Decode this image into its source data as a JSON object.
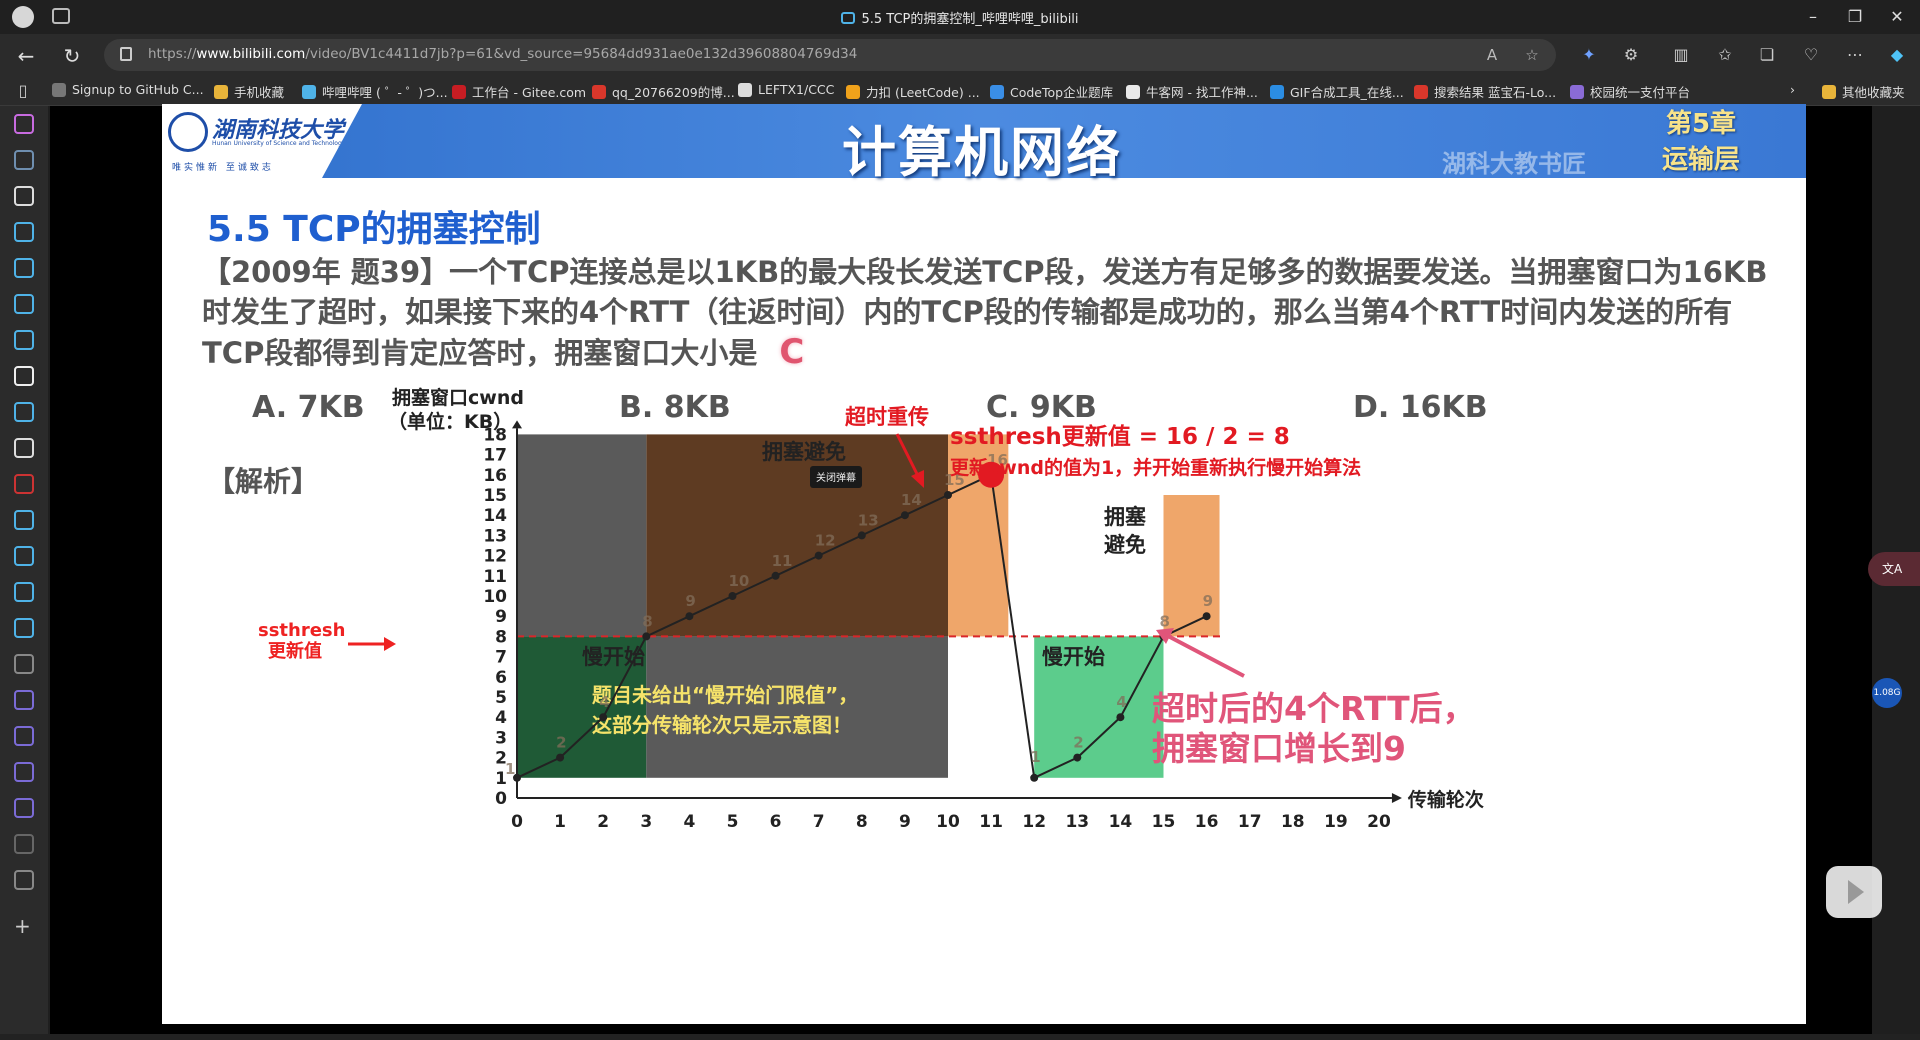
{
  "browser": {
    "window_title": "5.5 TCP的拥塞控制_哔哩哔哩_bilibili",
    "url_prefix": "https://",
    "url_domain": "www.bilibili.com",
    "url_path": "/video/BV1c4411d7jb?p=61&vd_source=95684dd931ae0e132d39608804769d34"
  },
  "bookmarks": [
    {
      "label": "Signup to GitHub C...",
      "color": "#777"
    },
    {
      "label": "手机收藏",
      "color": "#e8b43a"
    },
    {
      "label": "哔哩哔哩 ( ゜- ゜)つ...",
      "color": "#4fb3e8"
    },
    {
      "label": "工作台 - Gitee.com",
      "color": "#c71d23"
    },
    {
      "label": "qq_20766209的博...",
      "color": "#d9372b"
    },
    {
      "label": "LEFTX1/CCC",
      "color": "#ddd"
    },
    {
      "label": "力扣 (LeetCode) ...",
      "color": "#f0a21b"
    },
    {
      "label": "CodeTop企业题库",
      "color": "#3a8ee6"
    },
    {
      "label": "牛客网 - 找工作神...",
      "color": "#e9e9e9"
    },
    {
      "label": "GIF合成工具_在线...",
      "color": "#2b8de3"
    },
    {
      "label": "搜索结果 蓝宝石-Lo...",
      "color": "#d9372b"
    },
    {
      "label": "校园统一支付平台",
      "color": "#8a6bd6"
    }
  ],
  "bookmarks_other": "其他收藏夹",
  "slide": {
    "school": "湖南科技大学",
    "school_en": "Hunan University of Science and Technology",
    "motto": "唯实惟新 至诚致志",
    "course": "计算机网络",
    "chapter": "第5章",
    "chapter_sub": "运输层",
    "watermark": "湖科大教书匠",
    "section": "5.5 TCP的拥塞控制",
    "question": "【2009年 题39】一个TCP连接总是以1KB的最大段长发送TCP段，发送方有足够多的数据要发送。当拥塞窗口为16KB时发生了超时，如果接下来的4个RTT（往返时间）内的TCP段的传输都是成功的，那么当第4个RTT时间内发送的所有TCP段都得到肯定应答时，拥塞窗口大小是",
    "answer": "C",
    "options": [
      "A. 7KB",
      "B. 8KB",
      "C. 9KB",
      "D. 16KB"
    ],
    "analysis_label": "【解析】"
  },
  "chart_data": {
    "type": "line",
    "ylabel": "拥塞窗口cwnd",
    "ylabel2": "（单位：KB）",
    "xlabel": "传输轮次",
    "x_ticks": [
      0,
      1,
      2,
      3,
      4,
      5,
      6,
      7,
      8,
      9,
      10,
      11,
      12,
      13,
      14,
      15,
      16,
      17,
      18,
      19,
      20
    ],
    "y_ticks": [
      0,
      1,
      2,
      3,
      4,
      5,
      6,
      7,
      8,
      9,
      10,
      11,
      12,
      13,
      14,
      15,
      16,
      17,
      18
    ],
    "xlim": [
      0,
      20
    ],
    "ylim": [
      0,
      18
    ],
    "series": [
      {
        "x": [
          0,
          1,
          2,
          3,
          4,
          5,
          6,
          7,
          8,
          9,
          10,
          11
        ],
        "y": [
          1,
          2,
          4,
          8,
          9,
          10,
          11,
          12,
          13,
          14,
          15,
          16
        ]
      },
      {
        "x": [
          12,
          13,
          14,
          15,
          16
        ],
        "y": [
          1,
          2,
          4,
          8,
          9
        ]
      }
    ],
    "point_labels_1": [
      "1",
      "2",
      "4",
      "8",
      "9",
      "10",
      "11",
      "12",
      "13",
      "14",
      "15",
      "16"
    ],
    "point_labels_2": [
      "1",
      "2",
      "4",
      "8",
      "9"
    ],
    "ssthresh": 8,
    "ssthresh_label": "ssthresh",
    "ssthresh_label2": "更新值",
    "regions": [
      {
        "label": "慢开始",
        "x0": 0,
        "x1": 3,
        "y0": 1,
        "y1": 8,
        "color": "#1f5a36"
      },
      {
        "label": "拥塞避免",
        "x0": 3,
        "x1": 10,
        "y0": 8,
        "y1": 18,
        "color": "#5e3b22"
      },
      {
        "label": "",
        "x0": 0,
        "x1": 3,
        "y0": 8,
        "y1": 18,
        "color": "#5a5a5a"
      },
      {
        "label": "",
        "x0": 3,
        "x1": 10,
        "y0": 1,
        "y1": 8,
        "color": "#5a5a5a"
      },
      {
        "label": "",
        "x0": 10,
        "x1": 11.4,
        "y0": 8,
        "y1": 18,
        "color": "#efa66a"
      },
      {
        "label": "慢开始",
        "x0": 12,
        "x1": 15,
        "y0": 1,
        "y1": 8,
        "color": "#5ccc8c"
      },
      {
        "label": "拥塞避免",
        "x0": 15,
        "x1": 16.3,
        "y0": 8,
        "y1": 15,
        "color": "#efa66a"
      }
    ],
    "note_gray": [
      "题目未给出“慢开始门限值”，",
      "这部分传输轮次只是示意图！"
    ],
    "timeout_label": "超时重传",
    "ann1": "ssthresh更新值 = 16 / 2 = 8",
    "ann2": "更新cwnd的值为1，并开始重新执行慢开始算法",
    "ann3": "超时后的4个RTT后，",
    "ann4": "拥塞窗口增长到9",
    "danmaku_btn": "关闭弹幕"
  },
  "player": {
    "side_badge": "1.08G"
  }
}
